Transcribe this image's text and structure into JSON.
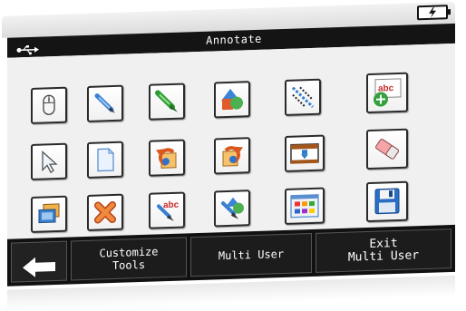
{
  "window": {
    "title": "Annotate"
  },
  "status": {
    "battery_icon": "battery-charging-icon",
    "usb_icon": "usb-icon"
  },
  "tools": [
    {
      "icon": "mouse-icon"
    },
    {
      "icon": "pen-icon"
    },
    {
      "icon": "highlighter-icon"
    },
    {
      "icon": "shapes-icon"
    },
    {
      "icon": "line-tool-icon"
    },
    {
      "icon": "add-text-icon"
    },
    {
      "icon": "pointer-icon"
    },
    {
      "icon": "blank-page-icon"
    },
    {
      "icon": "undo-icon"
    },
    {
      "icon": "redo-icon"
    },
    {
      "icon": "whiteboard-icon"
    },
    {
      "icon": "eraser-icon"
    },
    {
      "icon": "screen-capture-icon"
    },
    {
      "icon": "delete-icon"
    },
    {
      "icon": "text-pen-icon"
    },
    {
      "icon": "shape-pen-icon"
    },
    {
      "icon": "color-palette-icon"
    },
    {
      "icon": "save-icon"
    }
  ],
  "bottom": {
    "back_icon": "back-arrow-icon",
    "customize_label": "Customize\nTools",
    "multi_user_label": "Multi User",
    "exit_label": "Exit\nMulti User"
  }
}
